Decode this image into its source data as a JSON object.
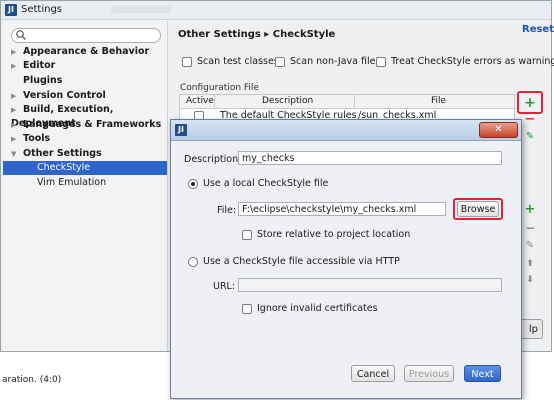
{
  "settings": {
    "title": "Settings",
    "logo_text": "JI",
    "search": {
      "placeholder": ""
    },
    "nav": [
      {
        "label": "Appearance & Behavior",
        "arrow": "▶"
      },
      {
        "label": "Editor",
        "arrow": "▶"
      },
      {
        "label": "Plugins",
        "arrow": ""
      },
      {
        "label": "Version Control",
        "arrow": "▶"
      },
      {
        "label": "Build, Execution, Deployment",
        "arrow": "▶"
      },
      {
        "label": "Languages & Frameworks",
        "arrow": "▶"
      },
      {
        "label": "Tools",
        "arrow": "▶"
      },
      {
        "label": "Other Settings",
        "arrow": "▼"
      }
    ],
    "nav_sub": [
      {
        "label": "CheckStyle",
        "selected": true
      },
      {
        "label": "Vim Emulation",
        "selected": false
      }
    ],
    "breadcrumb": "Other Settings ▸ CheckStyle",
    "reset": "Reset",
    "options": [
      {
        "label": "Scan test classes",
        "checked": false
      },
      {
        "label": "Scan non-Java files",
        "checked": false
      },
      {
        "label": "Treat CheckStyle errors as warnings",
        "checked": false
      }
    ],
    "config_file_label": "Configuration File",
    "table": {
      "columns": [
        "Active",
        "Description",
        "File"
      ],
      "rows": [
        {
          "active": false,
          "description": "The default CheckStyle rules",
          "file": "/sun_checks.xml"
        }
      ]
    },
    "toolbar": {
      "add": "+",
      "remove": "−",
      "edit": "✎"
    },
    "help_label": "lp",
    "status_text": "aration. (4:0)"
  },
  "dialog": {
    "logo_text": "JI",
    "close": "✕",
    "description_label": "Description:",
    "description_value": "my_checks",
    "local_file_option": "Use a local CheckStyle file",
    "file_label": "File:",
    "file_value": "F:\\eclipse\\checkstyle\\my_checks.xml",
    "browse": "Browse",
    "store_relative": "Store relative to project location",
    "http_option": "Use a CheckStyle file accessible via HTTP",
    "url_label": "URL:",
    "url_value": "",
    "ignore_certs": "Ignore invalid certificates",
    "cancel": "Cancel",
    "previous": "Previous",
    "next": "Next"
  },
  "colors": {
    "selection": "#2f65ca",
    "annotation": "#e0233b",
    "add_green": "#2e9a34",
    "remove_red": "#d13b2e"
  }
}
